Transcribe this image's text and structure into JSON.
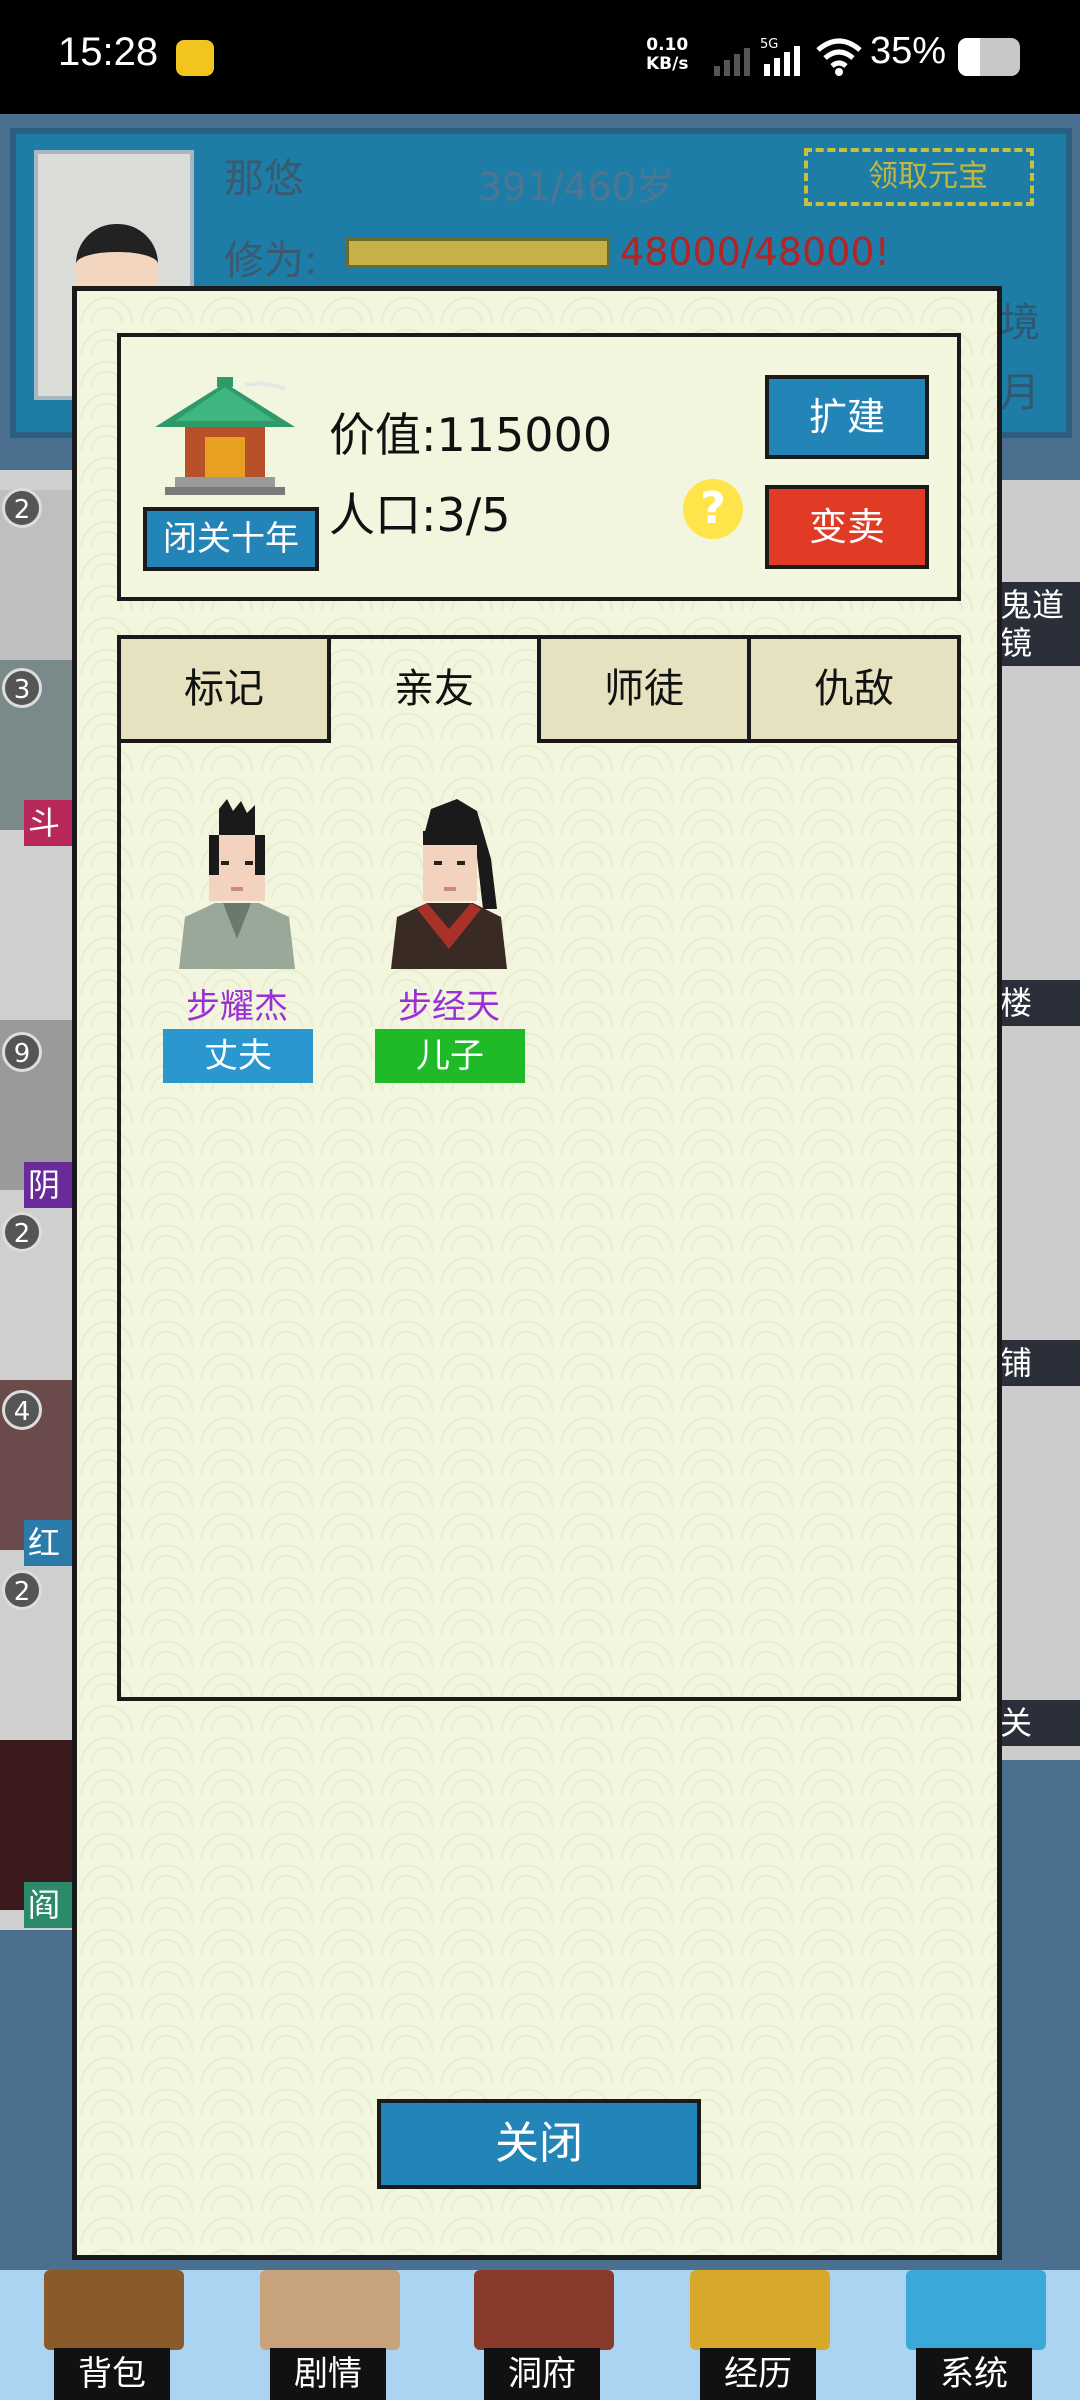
{
  "status_bar": {
    "time": "15:28",
    "net_speed_value": "0.10",
    "net_speed_unit": "KB/s",
    "network": "5G",
    "battery": "35%"
  },
  "background": {
    "player_name": "那悠",
    "age": "391/460岁",
    "reward_button": "领取元宝",
    "cultivation_label": "修为:",
    "cultivation_value": "48000/48000!",
    "cultivation_progress": 1.0,
    "right_text_1": "境",
    "right_text_2": "月",
    "left_badges": [
      "2",
      "3",
      "9",
      "2",
      "4",
      "2"
    ],
    "left_tags": [
      "斗",
      "阴",
      "红",
      "阎"
    ],
    "right_tags": [
      "鬼道",
      "镜",
      "楼",
      "铺",
      "关"
    ]
  },
  "dwelling": {
    "value_label": "价值:",
    "value": "115000",
    "population_label": "人口:",
    "population": "3/5",
    "seclusion_button": "闭关十年",
    "expand_button": "扩建",
    "sell_button": "变卖",
    "help_icon": "?"
  },
  "tabs": [
    {
      "label": "标记",
      "active": false
    },
    {
      "label": "亲友",
      "active": true
    },
    {
      "label": "师徒",
      "active": false
    },
    {
      "label": "仇敌",
      "active": false
    }
  ],
  "relatives": [
    {
      "name": "步耀杰",
      "relation": "丈夫",
      "relation_color": "#2b97cf"
    },
    {
      "name": "步经天",
      "relation": "儿子",
      "relation_color": "#1fba27"
    }
  ],
  "close_button": "关闭",
  "bottom_nav": [
    {
      "label": "背包",
      "icon": "backpack-icon"
    },
    {
      "label": "剧情",
      "icon": "story-icon"
    },
    {
      "label": "洞府",
      "icon": "dwelling-icon"
    },
    {
      "label": "经历",
      "icon": "experience-icon"
    },
    {
      "label": "系统",
      "icon": "settings-icon"
    }
  ]
}
